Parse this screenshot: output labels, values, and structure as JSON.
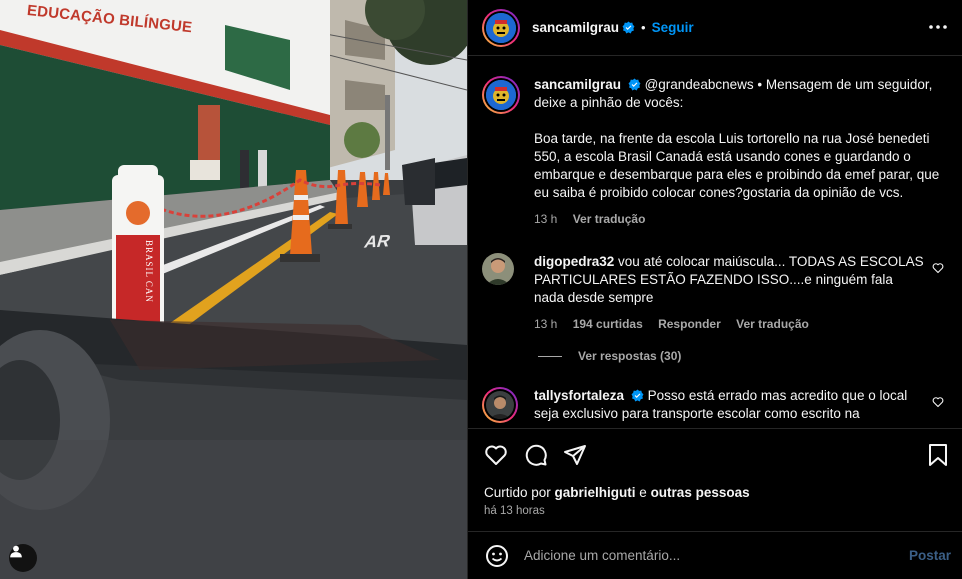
{
  "photo": {
    "school_banner": "EDUCAÇÃO BILÍNGUE",
    "cone_sign": "BRASIL CAN",
    "road_marking": "AR"
  },
  "post": {
    "author": "sancamilgrau",
    "follow_label": "Seguir",
    "more_icon": "more-horizontal-icon",
    "caption": {
      "author": "sancamilgrau",
      "mention": "@grandeabcnews",
      "line1": " • Mensagem de um seguidor, deixe a pinhão de vocês:",
      "body": "Boa tarde, na frente da escola Luis tortorello na rua José benedeti 550, a escola Brasil Canadá está usando cones e guardando o embarque e desembarque para eles e proibindo da emef parar, que eu saiba é proibido colocar cones?gostaria da opinião de vcs.",
      "time": "13 h",
      "translate": "Ver tradução"
    }
  },
  "comments": [
    {
      "author": "digopedra32",
      "text": "vou até colocar maiúscula... TODAS AS ESCOLAS PARTICULARES ESTÃO FAZENDO ISSO....e ninguém fala nada desde sempre",
      "time": "13 h",
      "likes": "194 curtidas",
      "reply": "Responder",
      "translate": "Ver tradução",
      "view_replies": "Ver respostas (30)"
    },
    {
      "author": "tallysfortaleza",
      "text": "Posso está errado mas acredito que o local seja exclusivo para transporte escolar como escrito na"
    }
  ],
  "actions": {
    "liked_prefix": "Curtido por ",
    "liked_user": "gabrielhiguti",
    "liked_join": " e ",
    "liked_others": "outras pessoas",
    "ago": "há 13 horas"
  },
  "add_comment": {
    "placeholder": "Adicione um comentário...",
    "post_label": "Postar"
  },
  "colors": {
    "accent": "#0095f6",
    "post_disabled": "#3b5f86",
    "secondary_text": "#a8a8a8",
    "divider": "#262626"
  }
}
